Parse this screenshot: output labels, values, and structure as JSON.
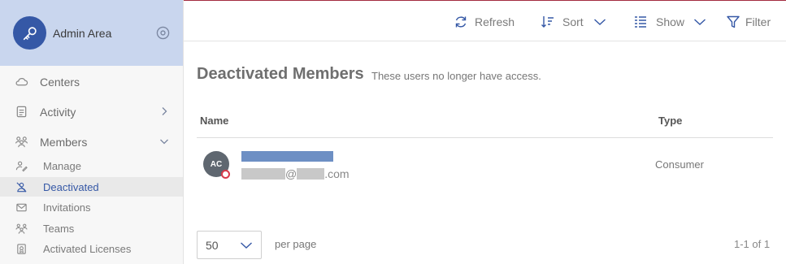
{
  "sidebar": {
    "title": "Admin Area",
    "items": [
      {
        "label": "Centers"
      },
      {
        "label": "Activity"
      },
      {
        "label": "Members"
      }
    ],
    "members_sub": [
      {
        "label": "Manage"
      },
      {
        "label": "Deactivated"
      },
      {
        "label": "Invitations"
      },
      {
        "label": "Teams"
      },
      {
        "label": "Activated Licenses"
      }
    ]
  },
  "toolbar": {
    "refresh_label": "Refresh",
    "sort_label": "Sort",
    "show_label": "Show",
    "filter_label": "Filter"
  },
  "main": {
    "title": "Deactivated Members",
    "subtitle": "These users no longer have access.",
    "columns": {
      "name": "Name",
      "type": "Type"
    },
    "rows": [
      {
        "initials": "AC",
        "email_at": "@",
        "email_domain_suffix": ".com",
        "type": "Consumer"
      }
    ]
  },
  "footer": {
    "per_page_value": "50",
    "per_page_label": "per page",
    "pagination": "1-1 of 1"
  },
  "colors": {
    "accent": "#3558a6",
    "header_bg": "#c9d6ee",
    "top_line": "#a32b40",
    "status_inactive": "#d83a4a"
  }
}
